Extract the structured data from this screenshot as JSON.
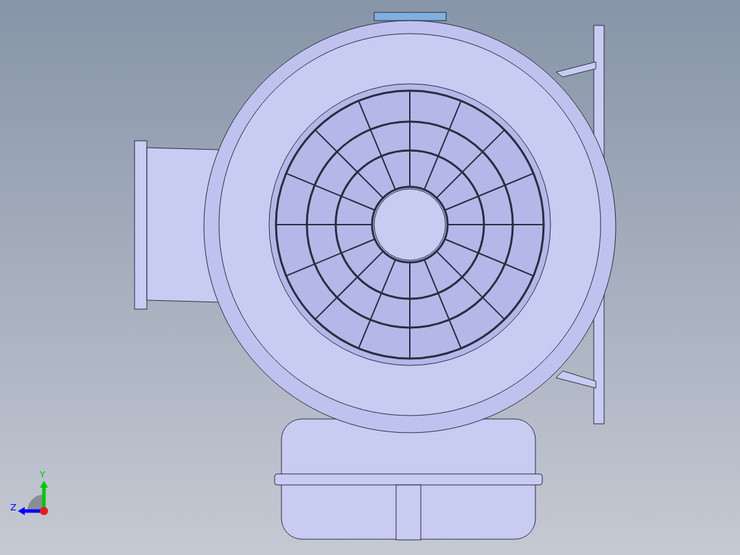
{
  "viewport": {
    "triad": {
      "axes": [
        {
          "label": "Y",
          "color": "#00c800"
        },
        {
          "label": "Z",
          "color": "#0000ff"
        }
      ]
    }
  }
}
